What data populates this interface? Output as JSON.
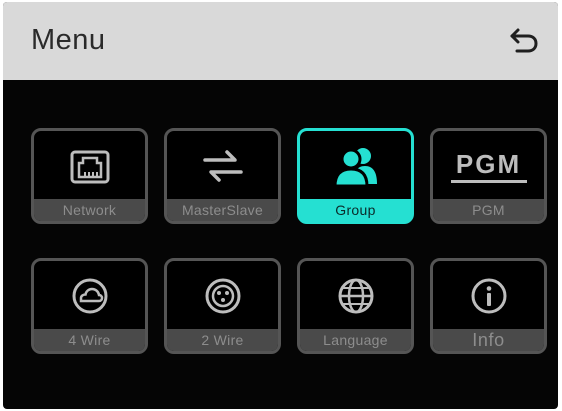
{
  "header": {
    "title": "Menu",
    "back_icon": "back-arrow-icon"
  },
  "tiles": [
    {
      "label": "Network",
      "icon": "ethernet-port-icon",
      "active": false
    },
    {
      "label": "MasterSlave",
      "icon": "swap-arrows-icon",
      "active": false
    },
    {
      "label": "Group",
      "icon": "users-group-icon",
      "active": true
    },
    {
      "label": "PGM",
      "icon": "pgm-text-icon",
      "icon_text": "PGM",
      "active": false
    },
    {
      "label": "4 Wire",
      "icon": "cloud-circle-icon",
      "active": false
    },
    {
      "label": "2 Wire",
      "icon": "xlr-connector-icon",
      "active": false
    },
    {
      "label": "Language",
      "icon": "globe-icon",
      "active": false
    },
    {
      "label": "Info",
      "icon": "info-icon",
      "active": false
    }
  ],
  "colors": {
    "accent": "#25e0d2",
    "header_bg": "#d9d9d9",
    "screen_bg": "#050505",
    "tile_border": "#555555",
    "label_bg": "#4a4a4a",
    "label_text": "#8d8d8d"
  }
}
